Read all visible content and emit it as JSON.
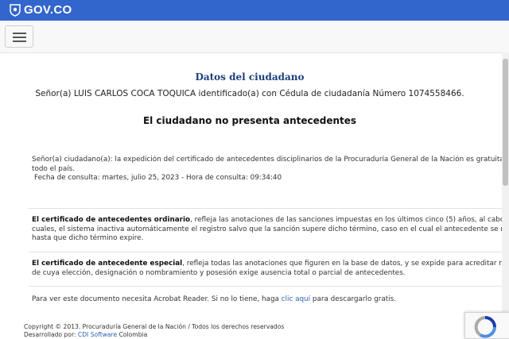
{
  "header": {
    "logo_text": "GOV.CO"
  },
  "navbar": {
    "menu_icon": "hamburger-menu-icon"
  },
  "main": {
    "title": "Datos del ciudadano",
    "citizen_line": "Señor(a)  LUIS CARLOS COCA TOQUICA identificado(a) con Cédula de ciudadanía Número 1074558466.",
    "status": "El ciudadano no presenta antecedentes",
    "notice_line1": "Señor(a) ciudadano(a): la expedición del certificado de antecedentes disciplinarios de la Procuraduría General de la Nación es gratuita en",
    "notice_line2": "todo el país.",
    "fecha": "Fecha de consulta: martes, julio 25, 2023 - Hora de consulta: 09:34:40",
    "ordinario_bold": "El certificado de antecedentes ordinario",
    "ordinario_line1": ", refleja las anotaciones de las sanciones impuestas en los últimos cinco (5) años, al cabo de los",
    "ordinario_line2": "cuales, el sistema inactiva automáticamente el registro salvo que la sanción supere dicho término, caso en el cual el antecedente se refle",
    "ordinario_line3": "hasta que dicho término expire.",
    "especial_bold": "El certificado de antecedente especial",
    "especial_line1": ", refleja todas las anotaciones que figuren en la base de datos, y se expide para acreditar requisit",
    "especial_line2": "de cuya elección, designación o nombramiento y posesión exige ausencia total o parcial de antecedentes.",
    "acrobat_pre": "Para ver este documento necesita Acrobat Reader. Si no lo tiene, haga ",
    "acrobat_link": "clic aquí",
    "acrobat_post": " para descargarlo gratis."
  },
  "footer": {
    "copyright": "Copyright © 2013. Procuraduría General de la Nación / Todos los derechos reservados",
    "dev_pre": "Desarrollado por: ",
    "dev_link": "CDI Software",
    "dev_post": " Colombia"
  },
  "colors": {
    "brand_blue": "#3366cc",
    "title_blue": "#1c3f7a",
    "link_blue": "#2a62b8"
  }
}
